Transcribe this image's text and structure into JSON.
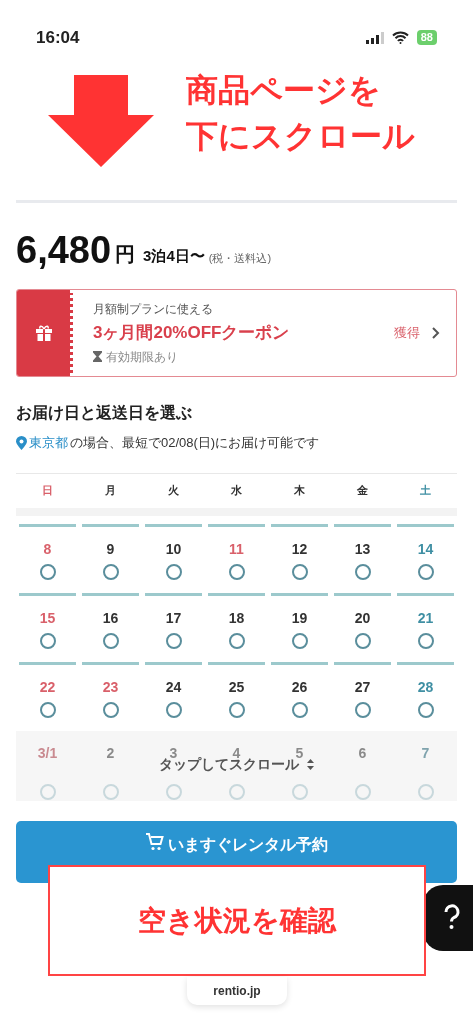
{
  "status_bar": {
    "time": "16:04",
    "battery": "88"
  },
  "annotation_top": {
    "lines": [
      "商品ページを",
      "下にスクロール"
    ]
  },
  "price": {
    "amount": "6,480",
    "unit": "円",
    "plan": "3泊4日〜",
    "note": "(税・送料込)"
  },
  "coupon": {
    "caption": "月額制プランに使える",
    "title": "3ヶ月間20%OFFクーポン",
    "validity": "有効期限あり",
    "action": "獲得"
  },
  "delivery": {
    "heading": "お届け日と返送日を選ぶ",
    "place": "東京都",
    "message": "の場合、最短で02/08(日)にお届け可能です"
  },
  "calendar": {
    "weekdays": [
      {
        "label": "日",
        "kind": "sunday"
      },
      {
        "label": "月",
        "kind": "weekday"
      },
      {
        "label": "火",
        "kind": "weekday"
      },
      {
        "label": "水",
        "kind": "weekday"
      },
      {
        "label": "木",
        "kind": "weekday"
      },
      {
        "label": "金",
        "kind": "weekday"
      },
      {
        "label": "土",
        "kind": "saturday"
      }
    ],
    "weeks": [
      {
        "muted": false,
        "days": [
          {
            "day": "8",
            "kind": "sunday"
          },
          {
            "day": "9",
            "kind": "weekday"
          },
          {
            "day": "10",
            "kind": "weekday"
          },
          {
            "day": "11",
            "kind": "holiday"
          },
          {
            "day": "12",
            "kind": "weekday"
          },
          {
            "day": "13",
            "kind": "weekday"
          },
          {
            "day": "14",
            "kind": "saturday"
          }
        ]
      },
      {
        "muted": false,
        "days": [
          {
            "day": "15",
            "kind": "sunday"
          },
          {
            "day": "16",
            "kind": "weekday"
          },
          {
            "day": "17",
            "kind": "weekday"
          },
          {
            "day": "18",
            "kind": "weekday"
          },
          {
            "day": "19",
            "kind": "weekday"
          },
          {
            "day": "20",
            "kind": "weekday"
          },
          {
            "day": "21",
            "kind": "saturday"
          }
        ]
      },
      {
        "muted": false,
        "days": [
          {
            "day": "22",
            "kind": "sunday"
          },
          {
            "day": "23",
            "kind": "holiday"
          },
          {
            "day": "24",
            "kind": "weekday"
          },
          {
            "day": "25",
            "kind": "weekday"
          },
          {
            "day": "26",
            "kind": "weekday"
          },
          {
            "day": "27",
            "kind": "weekday"
          },
          {
            "day": "28",
            "kind": "saturday"
          }
        ]
      },
      {
        "muted": true,
        "days": [
          {
            "day": "3/1",
            "kind": "sunday"
          },
          {
            "day": "2",
            "kind": "weekday"
          },
          {
            "day": "3",
            "kind": "weekday"
          },
          {
            "day": "4",
            "kind": "weekday"
          },
          {
            "day": "5",
            "kind": "weekday"
          },
          {
            "day": "6",
            "kind": "weekday"
          },
          {
            "day": "7",
            "kind": "saturday"
          }
        ]
      }
    ],
    "scroll_hint": "タップしてスクロール"
  },
  "reserve_button": {
    "label": "いますぐレンタル予約"
  },
  "annotation_bottom": {
    "label": "空き状況を確認"
  },
  "url_pill": {
    "label": "rentio.jp"
  }
}
